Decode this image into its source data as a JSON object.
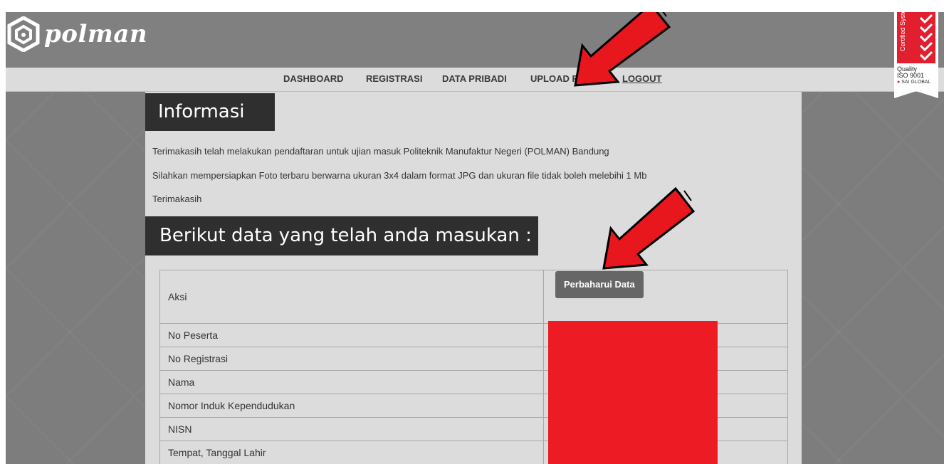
{
  "logo": {
    "text": "polman"
  },
  "nav": {
    "items": [
      {
        "label": "DASHBOARD"
      },
      {
        "label": "REGISTRASI"
      },
      {
        "label": "DATA PRIBADI"
      },
      {
        "label": "UPLOAD F"
      },
      {
        "label": "LOGOUT"
      }
    ]
  },
  "certificate": {
    "system": "Certified System",
    "quality": "Quality",
    "iso": "ISO 9001",
    "sai": "SAI GLOBAL"
  },
  "info": {
    "heading": "Informasi",
    "lines": [
      "Terimakasih telah melakukan pendaftaran untuk ujian masuk Politeknik Manufaktur Negeri (POLMAN) Bandung",
      "Silahkan mempersiapkan Foto terbaru berwarna ukuran 3x4 dalam format JPG dan ukuran file tidak boleh melebihi 1 Mb",
      "Terimakasih"
    ]
  },
  "data_section": {
    "heading": "Berikut data yang telah anda masukan :",
    "update_button": "Perbaharui Data",
    "rows": [
      {
        "label": "Aksi"
      },
      {
        "label": "No Peserta"
      },
      {
        "label": "No Registrasi"
      },
      {
        "label": "Nama"
      },
      {
        "label": "Nomor Induk Kependudukan"
      },
      {
        "label": "NISN"
      },
      {
        "label": "Tempat, Tanggal Lahir"
      }
    ]
  },
  "colors": {
    "annotation_arrow": "#e8161d",
    "redaction": "#ed1c24",
    "heading_bg": "#2f2f2f",
    "button_bg": "#666666"
  }
}
